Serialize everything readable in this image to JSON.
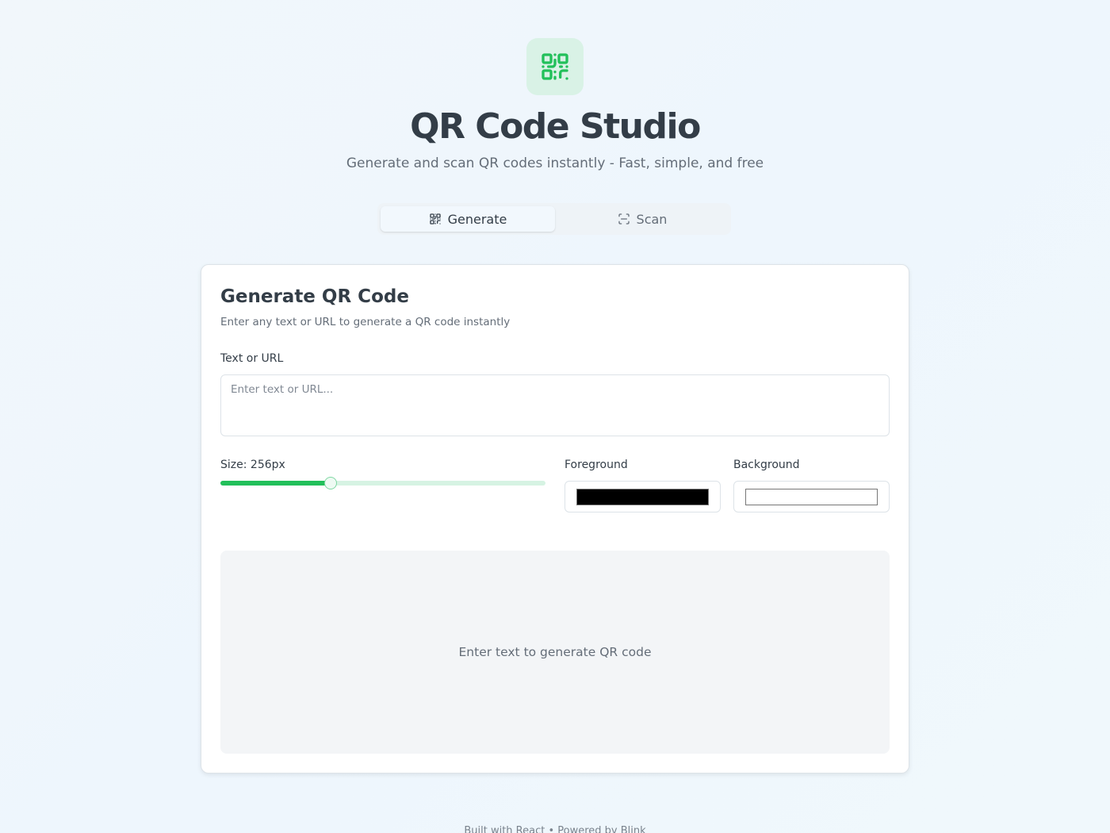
{
  "header": {
    "logo_icon": "qr-code-icon",
    "title": "QR Code Studio",
    "subtitle": "Generate and scan QR codes instantly - Fast, simple, and free"
  },
  "tabs": [
    {
      "label": "Generate",
      "icon": "qr-code-icon",
      "active": true
    },
    {
      "label": "Scan",
      "icon": "scan-icon",
      "active": false
    }
  ],
  "generator": {
    "title": "Generate QR Code",
    "description": "Enter any text or URL to generate a QR code instantly",
    "text_label": "Text or URL",
    "text_value": "",
    "text_placeholder": "Enter text or URL...",
    "size_label": "Size: 256px",
    "size_value": 256,
    "size_fraction": 0.34,
    "foreground_label": "Foreground",
    "foreground_color": "#000000",
    "background_label": "Background",
    "background_color": "#ffffff",
    "preview_placeholder": "Enter text to generate QR code"
  },
  "colors": {
    "accent": "#22c05a",
    "logo_bg": "#d9f2e6"
  },
  "footer": {
    "text": "Built with React • Powered by Blink"
  }
}
